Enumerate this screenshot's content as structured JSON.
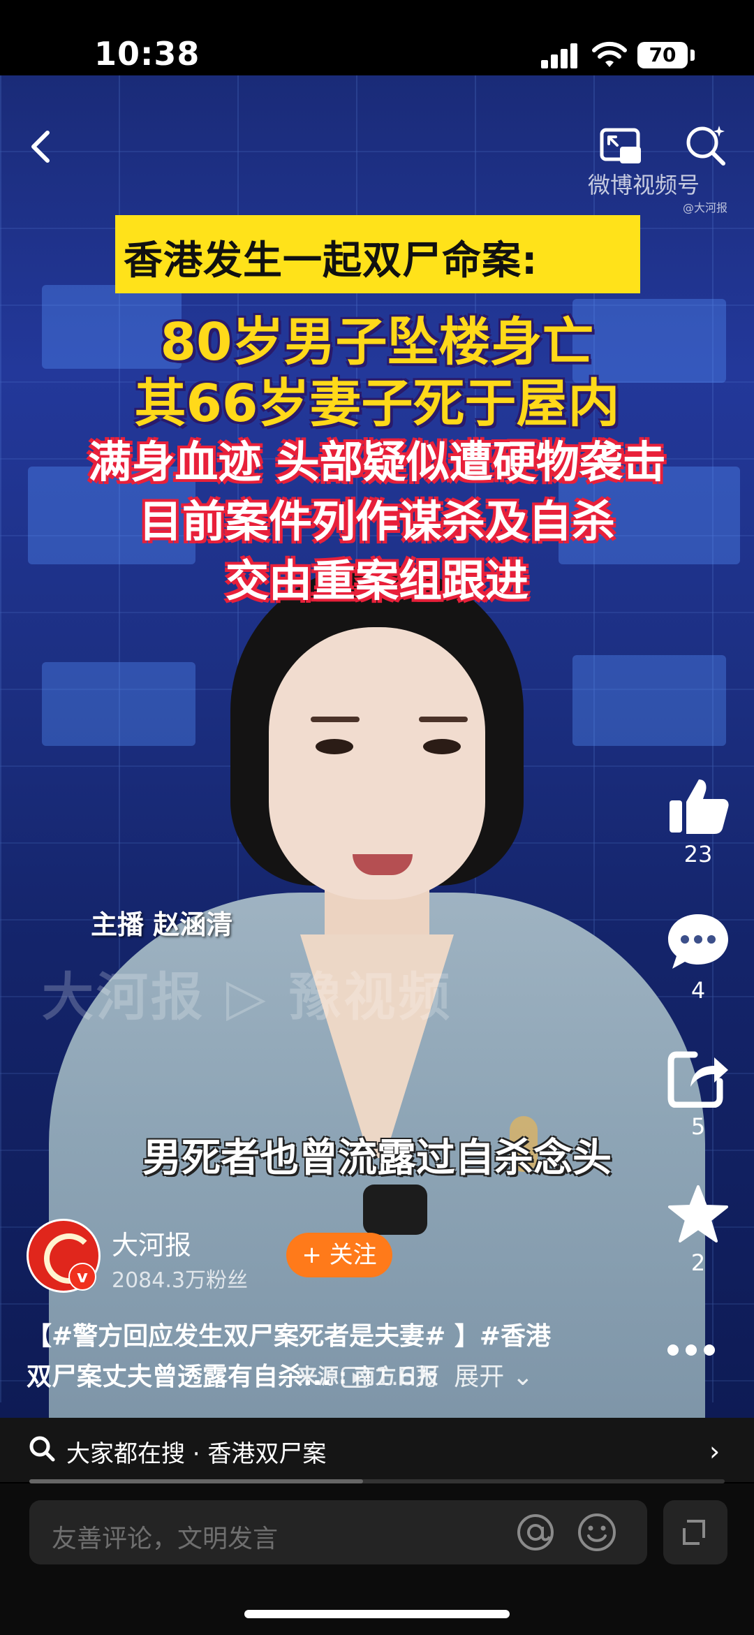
{
  "status_bar": {
    "time": "10:38",
    "battery": "70"
  },
  "video": {
    "watermark_top": "微博视频号",
    "watermark_sub": "@大河报",
    "title_bar": "香港发生一起双尸命案:",
    "headline_lines": [
      "80岁男子坠楼身亡",
      "其66岁妻子死于屋内",
      "满身血迹 头部疑似遭硬物袭击",
      "目前案件列作谋杀及自杀",
      "交由重案组跟进"
    ],
    "anchor_label": "主播 赵涵清",
    "watermark_main": "大河报 ▷ 豫视频",
    "subtitle": "男死者也曾流露过自杀念头",
    "source": "来源: 南方日报",
    "progress_percent": 48
  },
  "rail": {
    "likes": "23",
    "comments": "4",
    "shares": "5",
    "favorites": "2"
  },
  "author": {
    "name": "大河报",
    "fans": "2084.3万粉丝",
    "follow_label": "+ 关注",
    "verified_badge": "v"
  },
  "description": {
    "line1": "【#警方回应发生双尸案死者是夫妻# 】#香港",
    "line2": "双尸案丈夫曾透露有自杀...",
    "views": "1.6万",
    "expand": "展开"
  },
  "hot_search": {
    "text": "大家都在搜 · 香港双尸案",
    "arrow": "›"
  },
  "comment": {
    "placeholder": "友善评论，文明发言"
  },
  "icons": [
    "back-icon",
    "pip-icon",
    "search-icon",
    "like-icon",
    "comment-icon",
    "share-icon",
    "star-icon",
    "more-icon",
    "at-icon",
    "emoji-icon",
    "expand-icon"
  ]
}
